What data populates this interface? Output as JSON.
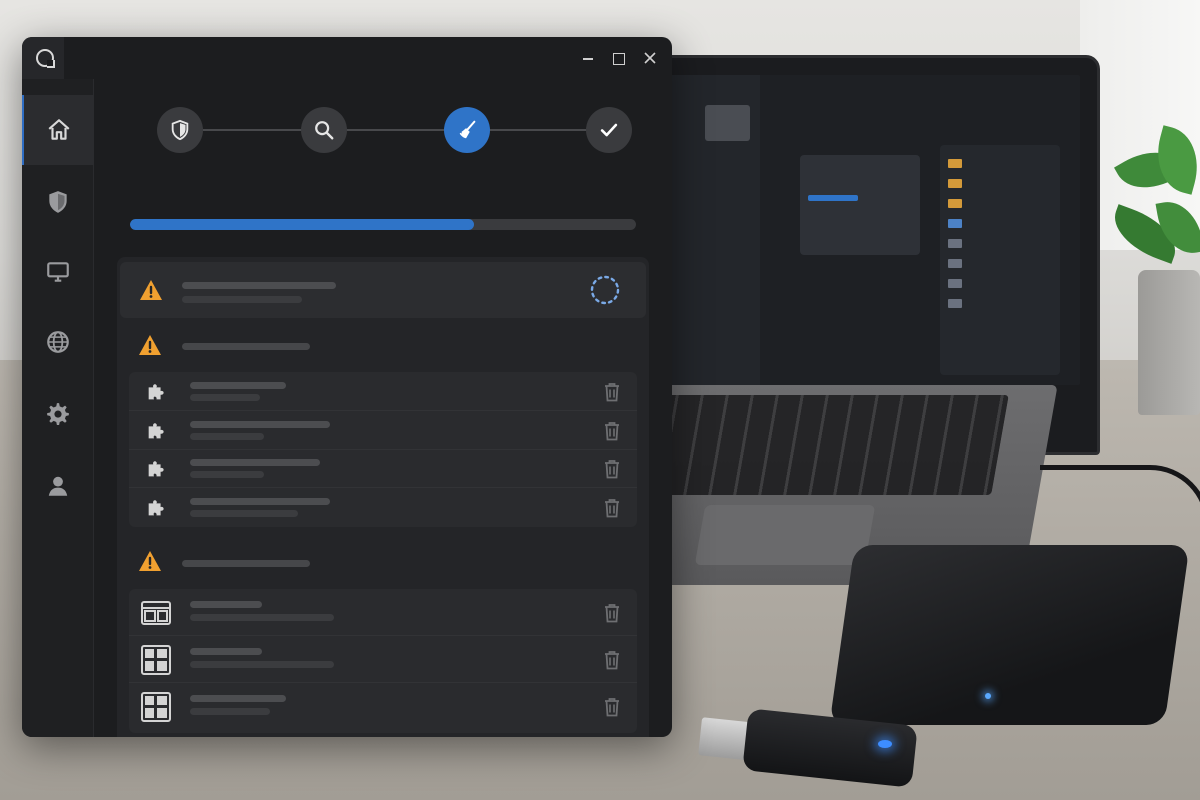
{
  "window": {
    "title": "",
    "controls": [
      "minimize-icon",
      "maximize-icon",
      "close-icon"
    ]
  },
  "sidebar": {
    "items": [
      {
        "icon": "home-icon",
        "active": true
      },
      {
        "icon": "shield-icon",
        "active": false
      },
      {
        "icon": "monitor-icon",
        "active": false
      },
      {
        "icon": "globe-icon",
        "active": false
      },
      {
        "icon": "gear-icon",
        "active": false
      },
      {
        "icon": "user-icon",
        "active": false
      }
    ]
  },
  "stepper": {
    "steps": [
      {
        "icon": "shield-icon",
        "state": "done"
      },
      {
        "icon": "search-icon",
        "state": "done"
      },
      {
        "icon": "broom-icon",
        "state": "active"
      },
      {
        "icon": "checkmark-icon",
        "state": "pending"
      }
    ]
  },
  "progress": {
    "value": 0.68
  },
  "scan": {
    "current_item": {
      "icon": "warning-icon",
      "status": "loading-spinner-icon"
    },
    "groups": [
      {
        "icon": "warning-icon",
        "item_icon": "puzzle-piece-icon",
        "items": 4
      },
      {
        "icon": "warning-icon",
        "item_icon": "grid-layout-icon",
        "items": 3
      }
    ]
  },
  "colors": {
    "accent": "#2f74c8",
    "warning": "#f0a030",
    "window_bg": "#1c1d1f",
    "panel_bg": "#242528"
  }
}
